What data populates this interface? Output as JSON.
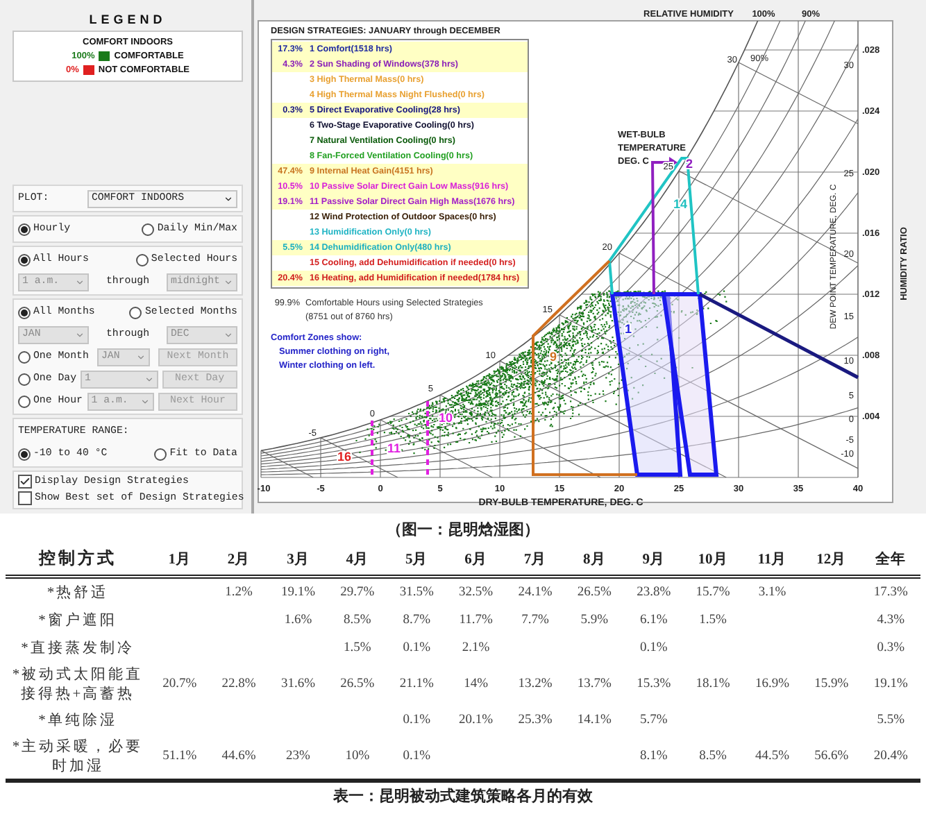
{
  "legend": {
    "title": "LEGEND",
    "heading": "COMFORT INDOORS",
    "items": [
      {
        "percent": "100%",
        "label": "COMFORTABLE",
        "color": "#1a7a1a"
      },
      {
        "percent": "0%",
        "label": "NOT COMFORTABLE",
        "color": "#e02020"
      }
    ]
  },
  "controls": {
    "plot": {
      "label": "PLOT:",
      "value": "COMFORT INDOORS",
      "disabled": false
    },
    "interval": [
      {
        "label": "Hourly",
        "selected": true
      },
      {
        "label": "Daily Min/Max",
        "selected": false
      }
    ],
    "hours": {
      "options": [
        {
          "label": "All Hours",
          "selected": true
        },
        {
          "label": "Selected Hours",
          "selected": false
        }
      ],
      "from": {
        "value": "1 a.m.",
        "disabled": true
      },
      "through": "through",
      "to": {
        "value": "midnight",
        "disabled": true
      }
    },
    "months": {
      "options": [
        {
          "label": "All Months",
          "selected": true
        },
        {
          "label": "Selected Months",
          "selected": false
        }
      ],
      "from": {
        "value": "JAN",
        "disabled": true
      },
      "through": "through",
      "to": {
        "value": "DEC",
        "disabled": true
      },
      "singles": [
        {
          "label": "One Month",
          "selected": false,
          "value": "JAN",
          "button": "Next Month",
          "disabled": true
        },
        {
          "label": "One Day",
          "selected": false,
          "value": "1",
          "button": "Next Day",
          "disabled": true
        },
        {
          "label": "One Hour",
          "selected": false,
          "value": "1 a.m.",
          "button": "Next Hour",
          "disabled": true
        }
      ]
    },
    "temperature": {
      "title": "TEMPERATURE RANGE:",
      "options": [
        {
          "label": "-10 to 40 °C",
          "selected": true
        },
        {
          "label": "Fit to Data",
          "selected": false
        }
      ]
    },
    "checks": [
      {
        "label": "Display Design Strategies",
        "checked": true
      },
      {
        "label": "Show Best set of Design Strategies",
        "checked": false
      }
    ]
  },
  "strategies": {
    "title": "DESIGN STRATEGIES:  JANUARY through DECEMBER",
    "items": [
      {
        "percent": "17.3%",
        "name": "1 Comfort(1518 hrs)",
        "color": "#1f2aa0",
        "selected": true
      },
      {
        "percent": "4.3%",
        "name": "2 Sun Shading of Windows(378 hrs)",
        "color": "#8a1fb8",
        "selected": true
      },
      {
        "name": "3 High Thermal Mass(0 hrs)",
        "color": "#e8a030",
        "selected": false
      },
      {
        "name": "4 High Thermal Mass Night Flushed(0 hrs)",
        "color": "#e8a030",
        "selected": false
      },
      {
        "percent": "0.3%",
        "name": "5 Direct Evaporative Cooling(28 hrs)",
        "color": "#141480",
        "selected": true
      },
      {
        "name": "6 Two-Stage Evaporative Cooling(0 hrs)",
        "color": "#101030",
        "selected": false
      },
      {
        "name": "7 Natural Ventilation Cooling(0 hrs)",
        "color": "#0a5a0a",
        "selected": false
      },
      {
        "name": "8 Fan-Forced Ventilation Cooling(0 hrs)",
        "color": "#22a022",
        "selected": false
      },
      {
        "percent": "47.4%",
        "name": "9 Internal Heat Gain(4151 hrs)",
        "color": "#c87420",
        "selected": true
      },
      {
        "percent": "10.5%",
        "name": "10 Passive Solar Direct Gain Low Mass(916 hrs)",
        "color": "#d81ed8",
        "selected": true
      },
      {
        "percent": "19.1%",
        "name": "11 Passive Solar Direct Gain High Mass(1676 hrs)",
        "color": "#a21ec8",
        "selected": true
      },
      {
        "name": "12 Wind Protection of Outdoor Spaces(0 hrs)",
        "color": "#3a2008",
        "selected": false
      },
      {
        "name": "13 Humidification Only(0 hrs)",
        "color": "#20b4c4",
        "selected": false
      },
      {
        "percent": "5.5%",
        "name": "14 Dehumidification Only(480 hrs)",
        "color": "#1cb0c0",
        "selected": true
      },
      {
        "name": "15 Cooling, add Dehumidification if needed(0 hrs)",
        "color": "#d42020",
        "selected": false
      },
      {
        "percent": "20.4%",
        "name": "16 Heating, add Humidification if needed(1784 hrs)",
        "color": "#d01c1c",
        "selected": true
      }
    ],
    "summary": {
      "percent": "99.9%",
      "text": "Comfortable Hours using Selected Strategies",
      "detail": "(8751 out of 8760 hrs)"
    },
    "notes": [
      "Comfort Zones show:",
      "Summer clothing on right,",
      "Winter clothing on left."
    ]
  },
  "chart": {
    "top_title": "RELATIVE HUMIDITY",
    "top_rh": [
      "100%",
      "90%"
    ],
    "rh_curve_label": "90%",
    "x_ticks": [
      "-10",
      "-5",
      "0",
      "5",
      "10",
      "15",
      "20",
      "25",
      "30",
      "35",
      "40"
    ],
    "x_title": "DRY-BULB TEMPERATURE, DEG. C",
    "humidity_ratio_ticks": [
      ".028",
      ".024",
      ".020",
      ".016",
      ".012",
      ".008",
      ".004"
    ],
    "humidity_ratio_title": "HUMIDITY RATIO",
    "dewpoint_ticks": [
      "30",
      "25",
      "20",
      "15",
      "10",
      "5",
      "0",
      "-5",
      "-10"
    ],
    "dewpoint_title": "DEW POINT TEMPERATURE, DEG. C",
    "wet_bulb_ticks": [
      "-5",
      "0",
      "5",
      "10",
      "15",
      "20",
      "25",
      "30"
    ],
    "wet_bulb_title": [
      "WET-BULB",
      "TEMPERATURE",
      "DEG. C"
    ],
    "zone_labels": [
      {
        "text": "16",
        "color": "#e02020"
      },
      {
        "text": "11",
        "color": "#e020e0"
      },
      {
        "text": "10",
        "color": "#e020e0"
      },
      {
        "text": "9",
        "color": "#d07020"
      },
      {
        "text": "1",
        "color": "#2020e0"
      },
      {
        "text": "14",
        "color": "#20c0c0"
      },
      {
        "text": "2",
        "color": "#9020c0"
      }
    ]
  },
  "figure_caption": "（图一：昆明焓湿图）",
  "table": {
    "columns": [
      "控制方式",
      "1月",
      "2月",
      "3月",
      "4月",
      "5月",
      "6月",
      "7月",
      "8月",
      "9月",
      "10月",
      "11月",
      "12月",
      "全年"
    ],
    "rows": [
      {
        "cells": [
          "*热舒适",
          "",
          "1.2%",
          "19.1%",
          "29.7%",
          "31.5%",
          "32.5%",
          "24.1%",
          "26.5%",
          "23.8%",
          "15.7%",
          "3.1%",
          "",
          "17.3%"
        ]
      },
      {
        "cells": [
          "*窗户遮阳",
          "",
          "",
          "1.6%",
          "8.5%",
          "8.7%",
          "11.7%",
          "7.7%",
          "5.9%",
          "6.1%",
          "1.5%",
          "",
          "",
          "4.3%"
        ]
      },
      {
        "cells": [
          "*直接蒸发制冷",
          "",
          "",
          "",
          "1.5%",
          "0.1%",
          "2.1%",
          "",
          "",
          "0.1%",
          "",
          "",
          "",
          "0.3%"
        ]
      },
      {
        "cells": [
          "*被动式太阳能直接得热+高蓄热",
          "20.7%",
          "22.8%",
          "31.6%",
          "26.5%",
          "21.1%",
          "14%",
          "13.2%",
          "13.7%",
          "15.3%",
          "18.1%",
          "16.9%",
          "15.9%",
          "19.1%"
        ]
      },
      {
        "cells": [
          "*单纯除湿",
          "",
          "",
          "",
          "",
          "0.1%",
          "20.1%",
          "25.3%",
          "14.1%",
          "5.7%",
          "",
          "",
          "",
          "5.5%"
        ]
      },
      {
        "cells": [
          "*主动采暖，必要时加湿",
          "51.1%",
          "44.6%",
          "23%",
          "10%",
          "0.1%",
          "",
          "",
          "",
          "8.1%",
          "8.5%",
          "44.5%",
          "56.6%",
          "20.4%"
        ]
      }
    ],
    "caption": "表一：昆明被动式建筑策略各月的有效"
  }
}
